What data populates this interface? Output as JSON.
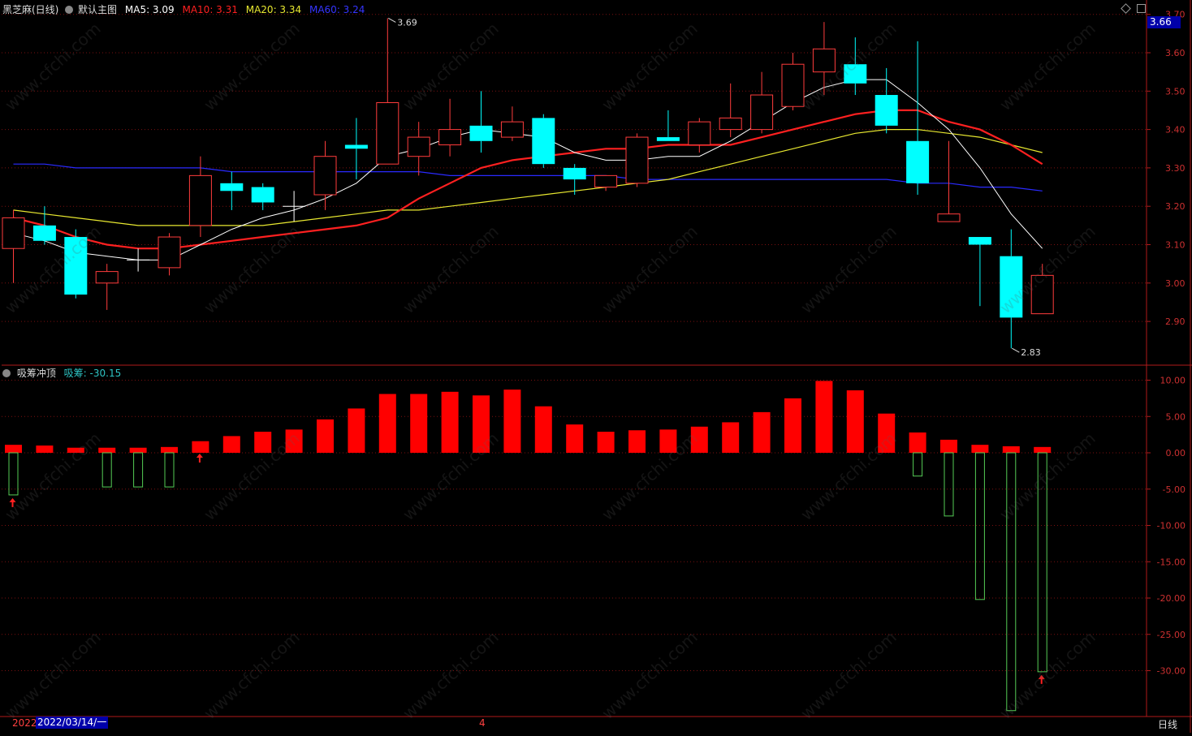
{
  "header": {
    "main": {
      "title": "黑芝麻(日线)",
      "chart_name": "默认主图",
      "ma5_label": "MA5: 3.09",
      "ma10_label": "MA10: 3.31",
      "ma20_label": "MA20: 3.34",
      "ma60_label": "MA60: 3.24"
    },
    "sub": {
      "title": "吸筹冲顶",
      "value_label": "吸筹: -30.15"
    }
  },
  "price_marker": "3.66",
  "bottom": {
    "year_label": "2022",
    "date_label": "2022/03/14/一",
    "month_label": "4",
    "period_label": "日线"
  },
  "watermark": "www.cfchi.com",
  "colors": {
    "up": "#ff3c3c",
    "down": "#00ffff",
    "ma5": "#ffffff",
    "ma10": "#ff2020",
    "ma20": "#e8e830",
    "ma60": "#2a2aff",
    "axis_red": "#b01a1a",
    "pos_bar": "#ff0000",
    "neg_bar": "#55cc55",
    "marker": "#0000aa"
  },
  "chart_data": [
    {
      "type": "candlestick",
      "title": "黑芝麻(日线)",
      "ylim": [
        2.82,
        3.7
      ],
      "y_ticks": [
        "3.70",
        "3.60",
        "3.50",
        "3.40",
        "3.30",
        "3.20",
        "3.10",
        "3.00",
        "2.90"
      ],
      "grid": true,
      "candles": [
        {
          "o": 3.09,
          "h": 3.19,
          "l": 3.0,
          "c": 3.17
        },
        {
          "o": 3.15,
          "h": 3.2,
          "l": 3.1,
          "c": 3.11
        },
        {
          "o": 3.12,
          "h": 3.14,
          "l": 2.96,
          "c": 2.97
        },
        {
          "o": 3.0,
          "h": 3.05,
          "l": 2.93,
          "c": 3.03
        },
        {
          "o": 3.06,
          "h": 3.09,
          "l": 3.03,
          "c": 3.06
        },
        {
          "o": 3.04,
          "h": 3.13,
          "l": 3.02,
          "c": 3.12
        },
        {
          "o": 3.15,
          "h": 3.33,
          "l": 3.12,
          "c": 3.28
        },
        {
          "o": 3.26,
          "h": 3.29,
          "l": 3.19,
          "c": 3.24
        },
        {
          "o": 3.25,
          "h": 3.26,
          "l": 3.19,
          "c": 3.21
        },
        {
          "o": 3.2,
          "h": 3.24,
          "l": 3.16,
          "c": 3.2
        },
        {
          "o": 3.23,
          "h": 3.37,
          "l": 3.19,
          "c": 3.33
        },
        {
          "o": 3.36,
          "h": 3.43,
          "l": 3.27,
          "c": 3.35
        },
        {
          "o": 3.31,
          "h": 3.69,
          "l": 3.31,
          "c": 3.47
        },
        {
          "o": 3.33,
          "h": 3.42,
          "l": 3.28,
          "c": 3.38
        },
        {
          "o": 3.36,
          "h": 3.48,
          "l": 3.33,
          "c": 3.4
        },
        {
          "o": 3.41,
          "h": 3.5,
          "l": 3.34,
          "c": 3.37
        },
        {
          "o": 3.38,
          "h": 3.46,
          "l": 3.37,
          "c": 3.42
        },
        {
          "o": 3.43,
          "h": 3.44,
          "l": 3.3,
          "c": 3.31
        },
        {
          "o": 3.3,
          "h": 3.31,
          "l": 3.23,
          "c": 3.27
        },
        {
          "o": 3.25,
          "h": 3.28,
          "l": 3.24,
          "c": 3.28
        },
        {
          "o": 3.26,
          "h": 3.39,
          "l": 3.25,
          "c": 3.38
        },
        {
          "o": 3.38,
          "h": 3.45,
          "l": 3.37,
          "c": 3.37
        },
        {
          "o": 3.36,
          "h": 3.43,
          "l": 3.34,
          "c": 3.42
        },
        {
          "o": 3.4,
          "h": 3.52,
          "l": 3.38,
          "c": 3.43
        },
        {
          "o": 3.4,
          "h": 3.55,
          "l": 3.39,
          "c": 3.49
        },
        {
          "o": 3.46,
          "h": 3.6,
          "l": 3.45,
          "c": 3.57
        },
        {
          "o": 3.55,
          "h": 3.68,
          "l": 3.49,
          "c": 3.61
        },
        {
          "o": 3.57,
          "h": 3.64,
          "l": 3.49,
          "c": 3.52
        },
        {
          "o": 3.49,
          "h": 3.56,
          "l": 3.39,
          "c": 3.41
        },
        {
          "o": 3.37,
          "h": 3.63,
          "l": 3.23,
          "c": 3.26
        },
        {
          "o": 3.16,
          "h": 3.37,
          "l": 3.16,
          "c": 3.18
        },
        {
          "o": 3.12,
          "h": 3.12,
          "l": 2.94,
          "c": 3.1
        },
        {
          "o": 3.07,
          "h": 3.14,
          "l": 2.83,
          "c": 2.91
        },
        {
          "o": 2.92,
          "h": 3.05,
          "l": 2.92,
          "c": 3.02
        }
      ],
      "series": [
        {
          "name": "MA5",
          "values": [
            3.13,
            3.11,
            3.08,
            3.07,
            3.06,
            3.06,
            3.1,
            3.14,
            3.17,
            3.19,
            3.22,
            3.26,
            3.33,
            3.35,
            3.38,
            3.4,
            3.39,
            3.38,
            3.34,
            3.32,
            3.32,
            3.33,
            3.33,
            3.37,
            3.42,
            3.47,
            3.51,
            3.53,
            3.53,
            3.47,
            3.4,
            3.3,
            3.18,
            3.09
          ]
        },
        {
          "name": "MA10",
          "values": [
            3.17,
            3.15,
            3.12,
            3.1,
            3.09,
            3.09,
            3.1,
            3.11,
            3.12,
            3.13,
            3.14,
            3.15,
            3.17,
            3.22,
            3.26,
            3.3,
            3.32,
            3.33,
            3.34,
            3.35,
            3.35,
            3.36,
            3.36,
            3.36,
            3.38,
            3.4,
            3.42,
            3.44,
            3.45,
            3.45,
            3.42,
            3.4,
            3.36,
            3.31
          ]
        },
        {
          "name": "MA20",
          "values": [
            3.19,
            3.18,
            3.17,
            3.16,
            3.15,
            3.15,
            3.15,
            3.15,
            3.15,
            3.16,
            3.17,
            3.18,
            3.19,
            3.19,
            3.2,
            3.21,
            3.22,
            3.23,
            3.24,
            3.25,
            3.26,
            3.27,
            3.29,
            3.31,
            3.33,
            3.35,
            3.37,
            3.39,
            3.4,
            3.4,
            3.39,
            3.38,
            3.36,
            3.34
          ]
        },
        {
          "name": "MA60",
          "values": [
            3.31,
            3.31,
            3.3,
            3.3,
            3.3,
            3.3,
            3.3,
            3.29,
            3.29,
            3.29,
            3.29,
            3.29,
            3.29,
            3.29,
            3.28,
            3.28,
            3.28,
            3.28,
            3.28,
            3.28,
            3.27,
            3.27,
            3.27,
            3.27,
            3.27,
            3.27,
            3.27,
            3.27,
            3.27,
            3.26,
            3.26,
            3.25,
            3.25,
            3.24
          ]
        }
      ],
      "annotations": [
        {
          "text": "3.69",
          "candle": 12,
          "value": 3.69
        },
        {
          "text": "2.83",
          "candle": 32,
          "value": 2.83
        }
      ]
    },
    {
      "type": "bar",
      "title": "吸筹冲顶",
      "ylim": [
        -36.5,
        11.5
      ],
      "y_ticks": [
        "10.00",
        "5.00",
        "0.00",
        "-5.00",
        "-10.00",
        "-15.00",
        "-20.00",
        "-25.00",
        "-30.00"
      ],
      "series": [
        {
          "name": "红柱",
          "values": [
            1.1,
            1.0,
            0.7,
            0.7,
            0.7,
            0.8,
            1.6,
            2.3,
            2.9,
            3.2,
            4.6,
            6.1,
            8.1,
            8.1,
            8.4,
            7.9,
            8.7,
            6.4,
            3.9,
            2.9,
            3.1,
            3.2,
            3.6,
            4.2,
            5.6,
            7.5,
            9.9,
            8.6,
            5.4,
            2.8,
            1.8,
            1.1,
            0.9,
            0.8
          ]
        },
        {
          "name": "吸筹",
          "values": [
            -5.8,
            0,
            0,
            -4.7,
            -4.7,
            -4.7,
            0,
            0,
            0,
            0,
            0,
            0,
            0,
            0,
            0,
            0,
            0,
            0,
            0,
            0,
            0,
            0,
            0,
            0,
            0,
            0,
            0,
            0,
            0,
            -3.2,
            -8.7,
            -20.2,
            -35.5,
            -30.15
          ]
        }
      ],
      "signal_arrows_at": [
        0,
        6,
        33
      ]
    }
  ]
}
